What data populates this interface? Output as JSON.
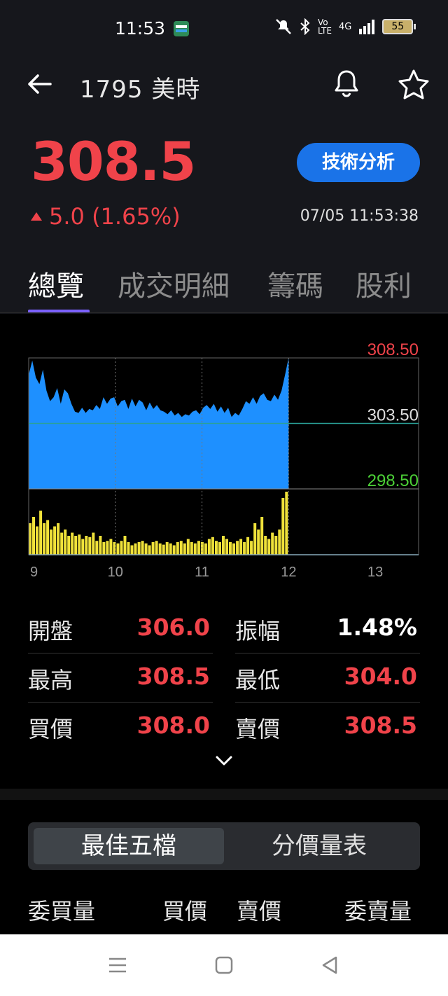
{
  "status_bar": {
    "time": "11:53",
    "network": "4G",
    "battery": "55"
  },
  "header": {
    "title": "1795 美時"
  },
  "quote": {
    "price": "308.5",
    "change": "5.0 (1.65%)",
    "timestamp": "07/05 11:53:38",
    "tech_button": "技術分析"
  },
  "tabs": [
    {
      "label": "總覽"
    },
    {
      "label": "成交明細"
    },
    {
      "label": "籌碼"
    },
    {
      "label": "股利"
    }
  ],
  "chart_data": {
    "type": "area",
    "y_labels": [
      "308.50",
      "303.50",
      "298.50"
    ],
    "x_labels": [
      "9",
      "10",
      "11",
      "12",
      "13"
    ],
    "reference_price": 303.5,
    "ylim": [
      298.5,
      308.5
    ],
    "price_series": [
      307.2,
      308.3,
      307.0,
      306.5,
      307.6,
      306.0,
      305.2,
      305.5,
      306.2,
      305.0,
      306.1,
      305.8,
      305.0,
      304.4,
      304.3,
      304.7,
      304.3,
      304.6,
      304.5,
      304.9,
      304.6,
      305.5,
      305.0,
      305.4,
      305.5,
      304.8,
      305.2,
      305.3,
      304.6,
      305.4,
      304.8,
      305.3,
      305.1,
      304.5,
      305.1,
      304.6,
      304.9,
      304.5,
      304.4,
      304.2,
      304.5,
      304.1,
      304.3,
      304.0,
      304.2,
      304.1,
      304.4,
      304.5,
      304.2,
      304.7,
      304.9,
      304.6,
      305.0,
      304.4,
      304.8,
      304.3,
      304.7,
      304.0,
      304.3,
      304.1,
      304.6,
      305.2,
      305.0,
      305.5,
      305.0,
      305.6,
      305.8,
      305.3,
      305.2,
      305.7,
      305.3,
      306.0,
      307.2,
      308.5
    ],
    "volume_series": [
      0.5,
      0.6,
      0.45,
      0.7,
      0.5,
      0.55,
      0.4,
      0.45,
      0.5,
      0.35,
      0.4,
      0.3,
      0.35,
      0.3,
      0.32,
      0.25,
      0.3,
      0.28,
      0.35,
      0.22,
      0.3,
      0.2,
      0.22,
      0.25,
      0.2,
      0.18,
      0.22,
      0.3,
      0.2,
      0.15,
      0.18,
      0.2,
      0.22,
      0.18,
      0.15,
      0.2,
      0.22,
      0.18,
      0.16,
      0.2,
      0.18,
      0.15,
      0.2,
      0.22,
      0.18,
      0.25,
      0.2,
      0.18,
      0.22,
      0.2,
      0.18,
      0.25,
      0.28,
      0.22,
      0.2,
      0.3,
      0.25,
      0.2,
      0.18,
      0.22,
      0.25,
      0.2,
      0.28,
      0.22,
      0.5,
      0.4,
      0.6,
      0.3,
      0.25,
      0.35,
      0.3,
      0.4,
      0.9,
      1.0
    ]
  },
  "stats": [
    {
      "label": "開盤",
      "value": "306.0",
      "label2": "振幅",
      "value2": "1.48%"
    },
    {
      "label": "最高",
      "value": "308.5",
      "label2": "最低",
      "value2": "304.0"
    },
    {
      "label": "買價",
      "value": "308.0",
      "label2": "賣價",
      "value2": "308.5"
    }
  ],
  "segments": {
    "best_five": "最佳五檔",
    "price_volume": "分價量表"
  },
  "orderbook_headers": {
    "bid_vol": "委買量",
    "bid": "買價",
    "ask": "賣價",
    "ask_vol": "委賣量"
  },
  "colors": {
    "up": "#f0434a",
    "down": "#4cd137",
    "accent": "#1a73e8",
    "area": "#1e90ff",
    "volume": "#f0e23a",
    "tab_indicator": "#7b61ff"
  }
}
